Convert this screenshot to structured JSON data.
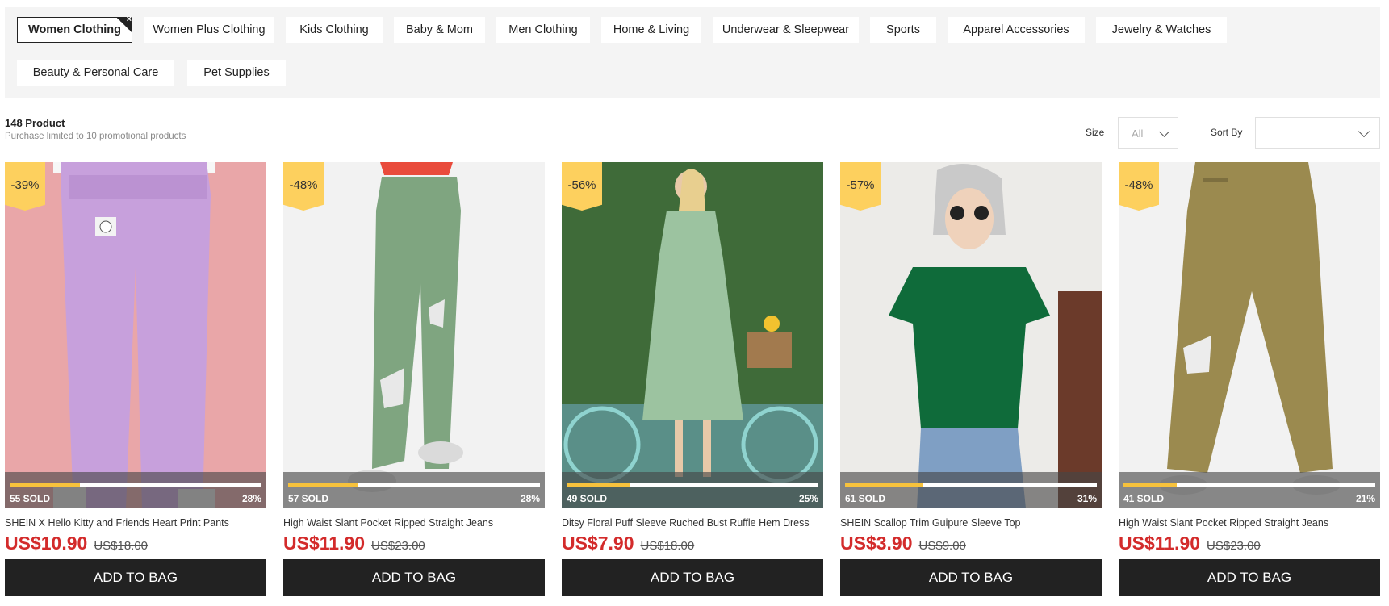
{
  "categories": [
    {
      "label": "Women Clothing",
      "active": true,
      "close_glyph": "×"
    },
    {
      "label": "Women Plus Clothing"
    },
    {
      "label": "Kids Clothing"
    },
    {
      "label": "Baby & Mom"
    },
    {
      "label": "Men Clothing"
    },
    {
      "label": "Home & Living"
    },
    {
      "label": "Underwear & Sleepwear"
    },
    {
      "label": "Sports"
    },
    {
      "label": "Apparel Accessories"
    },
    {
      "label": "Jewelry & Watches"
    },
    {
      "label": "Beauty & Personal Care"
    },
    {
      "label": "Pet Supplies"
    }
  ],
  "summary": {
    "product_count": "148 Product",
    "limit_note": "Purchase limited to 10 promotional products"
  },
  "filters": {
    "size_label": "Size",
    "size_value": "All",
    "sort_label": "Sort By",
    "sort_value": ""
  },
  "colors": {
    "accent_price": "#d32b2b",
    "badge": "#fdd05e",
    "progress": "#f7c23c",
    "button": "#222222"
  },
  "products": [
    {
      "discount": "-39%",
      "sold": "55 SOLD",
      "sold_percent": "28%",
      "progress": 0.28,
      "name": "SHEIN X Hello Kitty and Friends Heart Print Pants",
      "price": "US$10.90",
      "original_price": "US$18.00",
      "button": "ADD TO BAG",
      "image": "lilac-wide-leg-pants-photo"
    },
    {
      "discount": "-48%",
      "sold": "57 SOLD",
      "sold_percent": "28%",
      "progress": 0.28,
      "name": "High Waist Slant Pocket Ripped Straight Jeans",
      "price": "US$11.90",
      "original_price": "US$23.00",
      "button": "ADD TO BAG",
      "image": "green-ripped-jeans-photo"
    },
    {
      "discount": "-56%",
      "sold": "49 SOLD",
      "sold_percent": "25%",
      "progress": 0.25,
      "name": "Ditsy Floral Puff Sleeve Ruched Bust Ruffle Hem Dress",
      "price": "US$7.90",
      "original_price": "US$18.00",
      "button": "ADD TO BAG",
      "image": "floral-dress-bicycle-photo"
    },
    {
      "discount": "-57%",
      "sold": "61 SOLD",
      "sold_percent": "31%",
      "progress": 0.31,
      "name": "SHEIN Scallop Trim Guipure Sleeve Top",
      "price": "US$3.90",
      "original_price": "US$9.00",
      "button": "ADD TO BAG",
      "image": "green-scallop-top-photo"
    },
    {
      "discount": "-48%",
      "sold": "41 SOLD",
      "sold_percent": "21%",
      "progress": 0.21,
      "name": "High Waist Slant Pocket Ripped Straight Jeans",
      "price": "US$11.90",
      "original_price": "US$23.00",
      "button": "ADD TO BAG",
      "image": "khaki-ripped-jeans-photo"
    }
  ]
}
